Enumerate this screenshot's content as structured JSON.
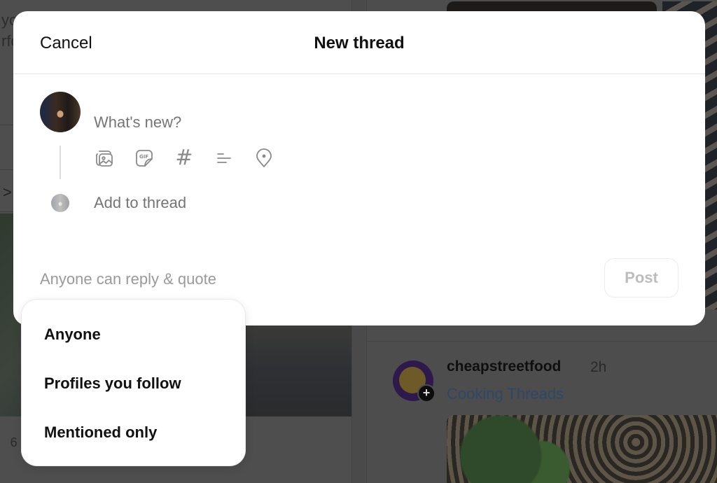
{
  "background": {
    "left_text_lines": [
      "yo",
      "rfo"
    ],
    "chevron": ">",
    "count_fragment": "  6",
    "post": {
      "username": "cheapstreetfood",
      "time": "2h",
      "tag": "Cooking Threads",
      "follow_badge": "+"
    }
  },
  "modal": {
    "cancel_label": "Cancel",
    "title": "New thread",
    "composer": {
      "placeholder": "What's new?",
      "value": "",
      "add_to_thread_placeholder": "Add to thread",
      "tools": [
        {
          "name": "attach-media",
          "icon": "image-stack-icon"
        },
        {
          "name": "gif",
          "icon": "gif-sticker-icon",
          "glyph": "GIF"
        },
        {
          "name": "hashtag",
          "icon": "hashtag-icon",
          "glyph": "#"
        },
        {
          "name": "poll",
          "icon": "poll-lines-icon"
        },
        {
          "name": "location",
          "icon": "location-pin-icon"
        }
      ]
    },
    "reply_setting": "Anyone can reply & quote",
    "post_label": "Post"
  },
  "reply_dropdown": {
    "options": [
      "Anyone",
      "Profiles you follow",
      "Mentioned only"
    ]
  }
}
